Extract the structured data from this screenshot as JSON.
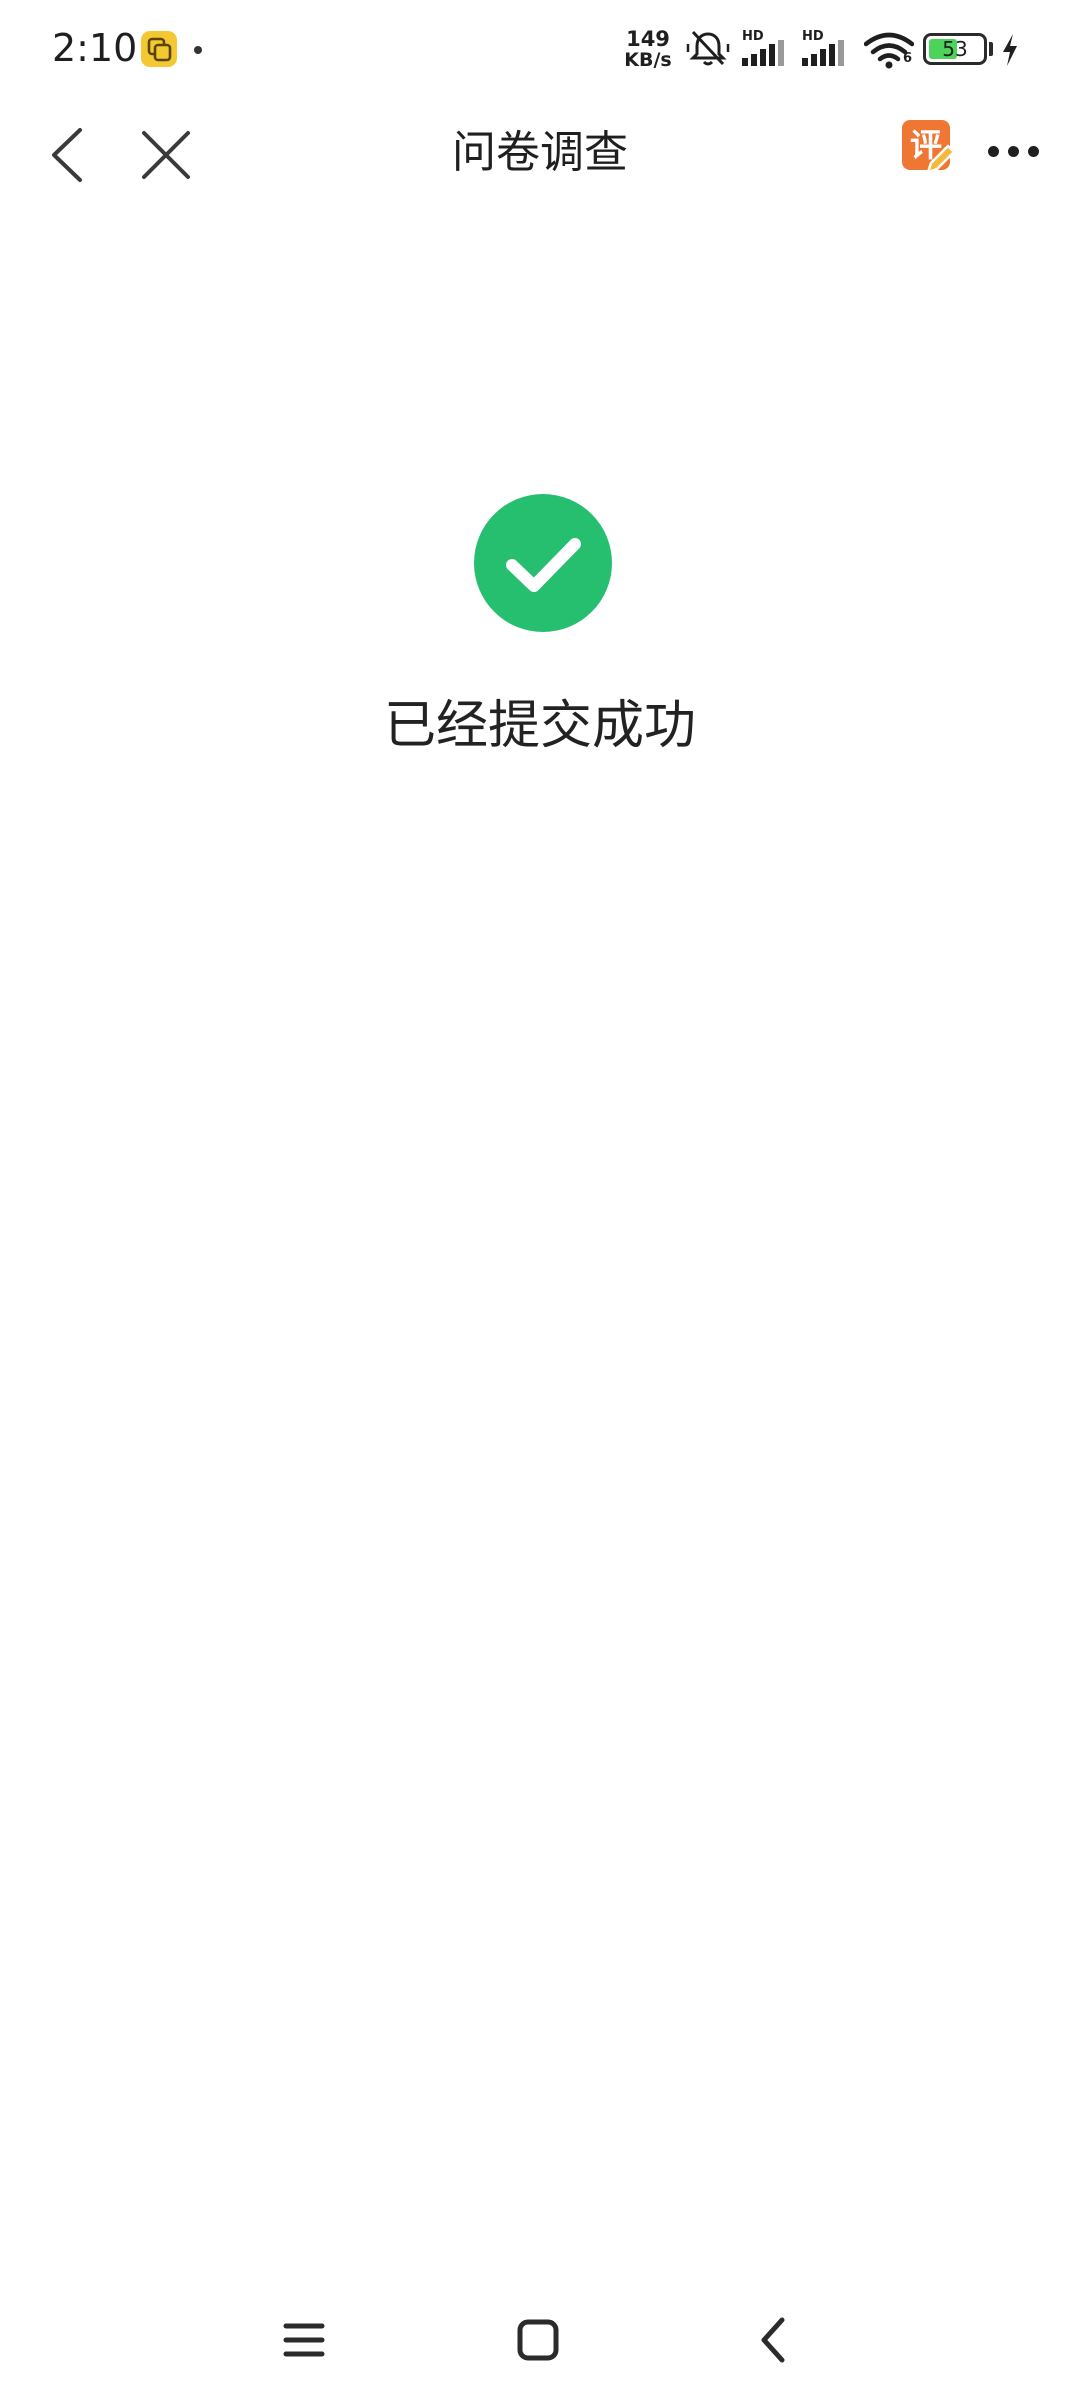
{
  "status_bar": {
    "time": "2:10",
    "net_speed_value": "149",
    "net_speed_unit": "KB/s",
    "signal_label_1": "HD",
    "signal_label_2": "HD",
    "wifi_label": "6",
    "battery_level": "53"
  },
  "title_bar": {
    "title": "问卷调查",
    "rate_badge": "评"
  },
  "main": {
    "success_message": "已经提交成功"
  },
  "colors": {
    "success_green": "#26bf6f",
    "rate_orange": "#ef7733",
    "battery_green": "#4cd35a"
  },
  "icons": {
    "back": "chevron-left-icon",
    "close": "close-icon",
    "rate": "rate-edit-icon",
    "more": "more-horizontal-icon",
    "success": "check-circle-icon",
    "nav_menu": "menu-icon",
    "nav_home": "home-square-icon",
    "nav_back": "back-arrow-icon"
  }
}
